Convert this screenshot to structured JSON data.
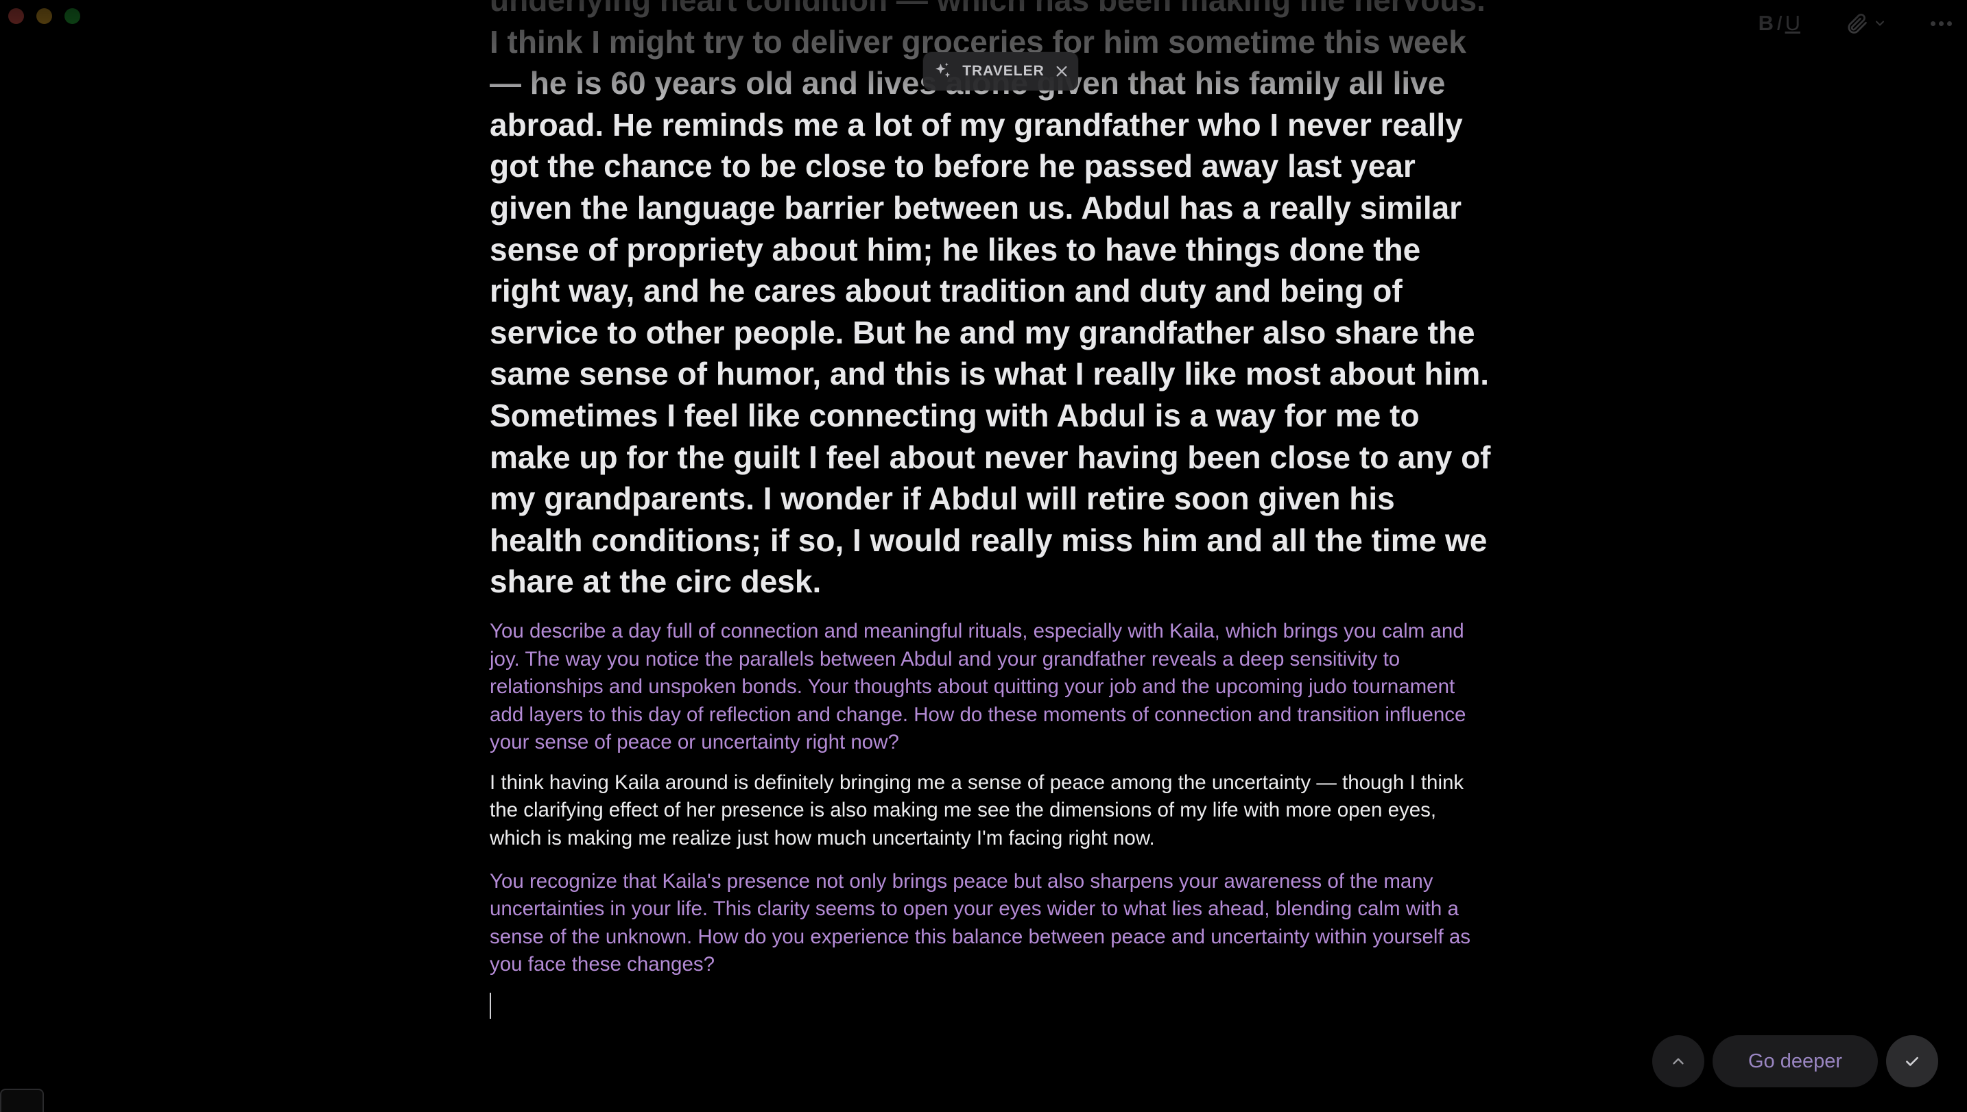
{
  "window": {
    "controls": [
      "close",
      "minimize",
      "maximize"
    ]
  },
  "toolbar": {
    "bold": "B",
    "italic": "I",
    "underline": "U",
    "attach_icon": "paperclip-icon",
    "more_icon": "ellipsis-icon"
  },
  "traveler": {
    "label": "TRAVELER",
    "icon": "sparkle-icon"
  },
  "entry": {
    "text": "underlying heart condition — which has been making me nervous. I think I might try to deliver groceries for him sometime this week — he is 60 years old and lives alone given that his family all live abroad. He reminds me a lot of my grandfather who I never really got the chance to be close to before he passed away last year given the language barrier between us. Abdul has a really similar sense of propriety about him; he likes to have things done the right way, and he cares about tradition and duty and being of service to other people. But he and my grandfather also share the same sense of humor, and this is what I really like most about him. Sometimes I feel like connecting with Abdul is a way for me to make up for the guilt I feel about never having been close to any of my grandparents. I wonder if Abdul will retire soon given his health conditions; if so, I would really miss him and all the time we share at the circ desk."
  },
  "conversation": {
    "prompt_1": "You describe a day full of connection and meaningful rituals, especially with Kaila, which brings you calm and joy. The way you notice the parallels between Abdul and your grandfather reveals a deep sensitivity to relationships and unspoken bonds. Your thoughts about quitting your job and the upcoming judo tournament add layers to this day of reflection and change. How do these moments of connection and transition influence your sense of peace or uncertainty right now?",
    "reply_1": "I think having Kaila around is definitely bringing me a sense of peace among the uncertainty — though I think the clarifying effect of her presence is also making me see the dimensions of my life with more open eyes, which is making me realize just how much uncertainty I'm facing right now.",
    "prompt_2": "You recognize that Kaila's presence not only brings peace but also sharpens your awareness of the many uncertainties in your life. This clarity seems to open your eyes wider to what lies ahead, blending calm with a sense of the unknown. How do you experience this balance between peace and uncertainty within yourself as you face these changes?"
  },
  "controls": {
    "scroll_up_icon": "chevron-up-icon",
    "go_deeper_label": "Go deeper",
    "confirm_icon": "checkmark-icon"
  },
  "colors": {
    "background": "#000000",
    "prompt_text": "#b48bd6",
    "reply_text": "#ececee",
    "entry_text": "#e8e8ea",
    "go_deeper_text": "#9a86c2"
  }
}
